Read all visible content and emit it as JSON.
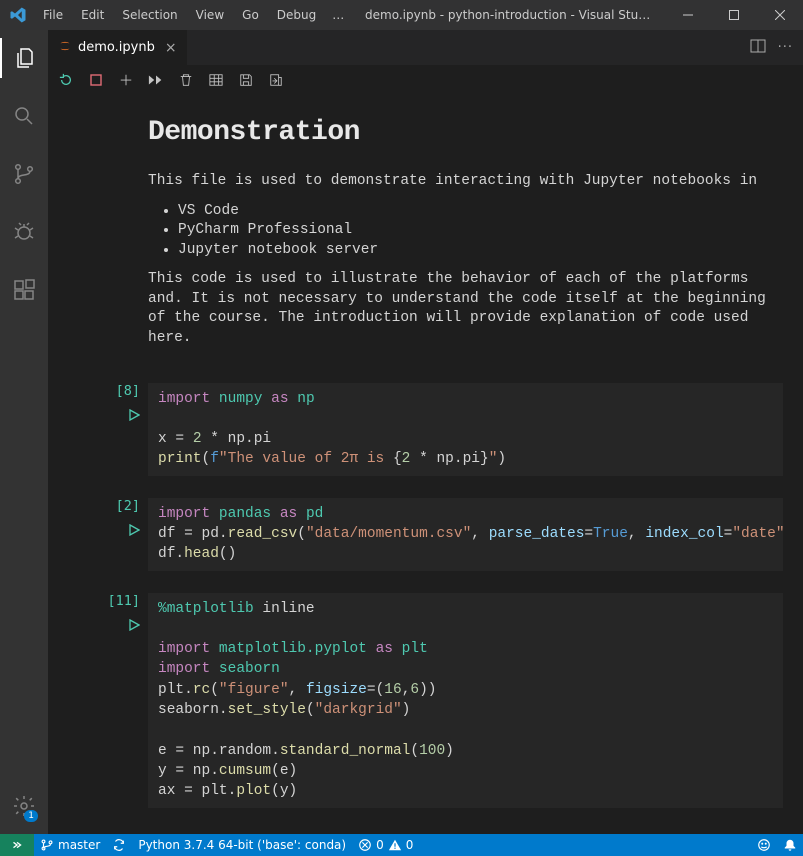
{
  "menu": {
    "file": "File",
    "edit": "Edit",
    "selection": "Selection",
    "view": "View",
    "go": "Go",
    "debug": "Debug",
    "more": "…"
  },
  "window_title": "demo.ipynb - python-introduction - Visual Stu…",
  "tab": {
    "filename": "demo.ipynb"
  },
  "markdown": {
    "heading": "Demonstration",
    "p1": "This file is used to demonstrate interacting with Jupyter notebooks in",
    "li1": "VS Code",
    "li2": "PyCharm Professional",
    "li3": "Jupyter notebook server",
    "p2": "This code is used to illustrate the behavior of each of the platforms and. It is not necessary to understand the code itself at the beginning of the course. The introduction will provide explanation of code used here."
  },
  "cells": {
    "c1": {
      "count": "[8]"
    },
    "c2": {
      "count": "[2]"
    },
    "c3": {
      "count": "[11]"
    }
  },
  "status": {
    "branch": "master",
    "interpreter": "Python 3.7.4 64-bit ('base': conda)",
    "errors": "0",
    "warnings": "0"
  }
}
